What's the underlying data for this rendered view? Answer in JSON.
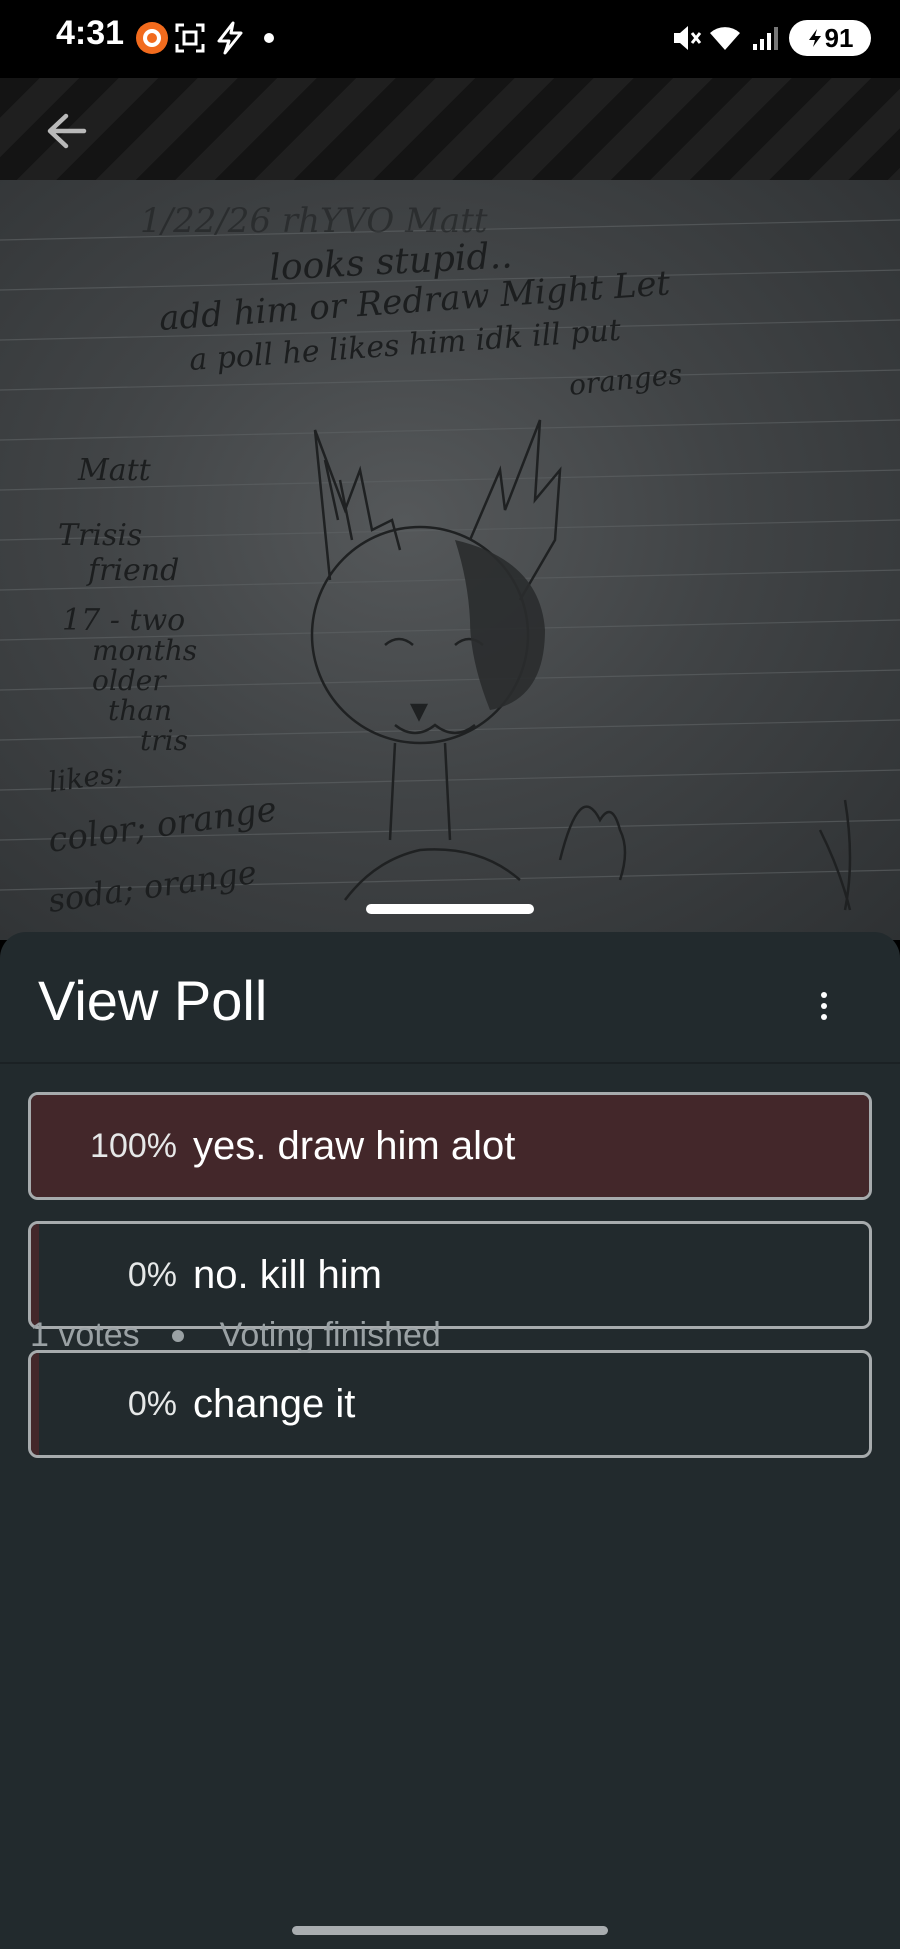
{
  "status_bar": {
    "time": "4:31",
    "battery": "91",
    "icons": [
      "app-notification-icon",
      "screenshot-icon",
      "flash-icon",
      "dot-icon",
      "mute-icon",
      "wifi-icon",
      "signal-icon",
      "battery-icon"
    ]
  },
  "header": {
    "back_icon": "back-arrow-icon"
  },
  "media": {
    "description_icon": "sketch-image",
    "handwriting": {
      "line1": "1/22/26      rhYVO          Matt",
      "line2": "looks stupid..",
      "line3": "add him or Redraw   Might Let",
      "line4": "a poll       he likes       him idk  ill put",
      "line5": "oranges",
      "side_notes": [
        "Matt",
        "Trisis",
        "friend",
        "17 - two",
        "months",
        "older",
        "than",
        "tris",
        "likes;",
        "color; orange",
        "soda; orange"
      ]
    }
  },
  "sheet": {
    "title": "View Poll",
    "more_icon": "more-vertical-icon"
  },
  "poll": {
    "options": [
      {
        "percent": "100%",
        "label": "yes. draw him alot",
        "fraction": 1.0
      },
      {
        "percent": "0%",
        "label": "no. kill him",
        "fraction": 0.0
      },
      {
        "percent": "0%",
        "label": "change it",
        "fraction": 0.0
      }
    ],
    "votes": "1 votes",
    "status": "Voting finished"
  },
  "colors": {
    "sheet_bg": "#222a2d",
    "winner_fill": "#43272a",
    "border": "#a7abad",
    "muted_text": "#9aa1a4"
  }
}
